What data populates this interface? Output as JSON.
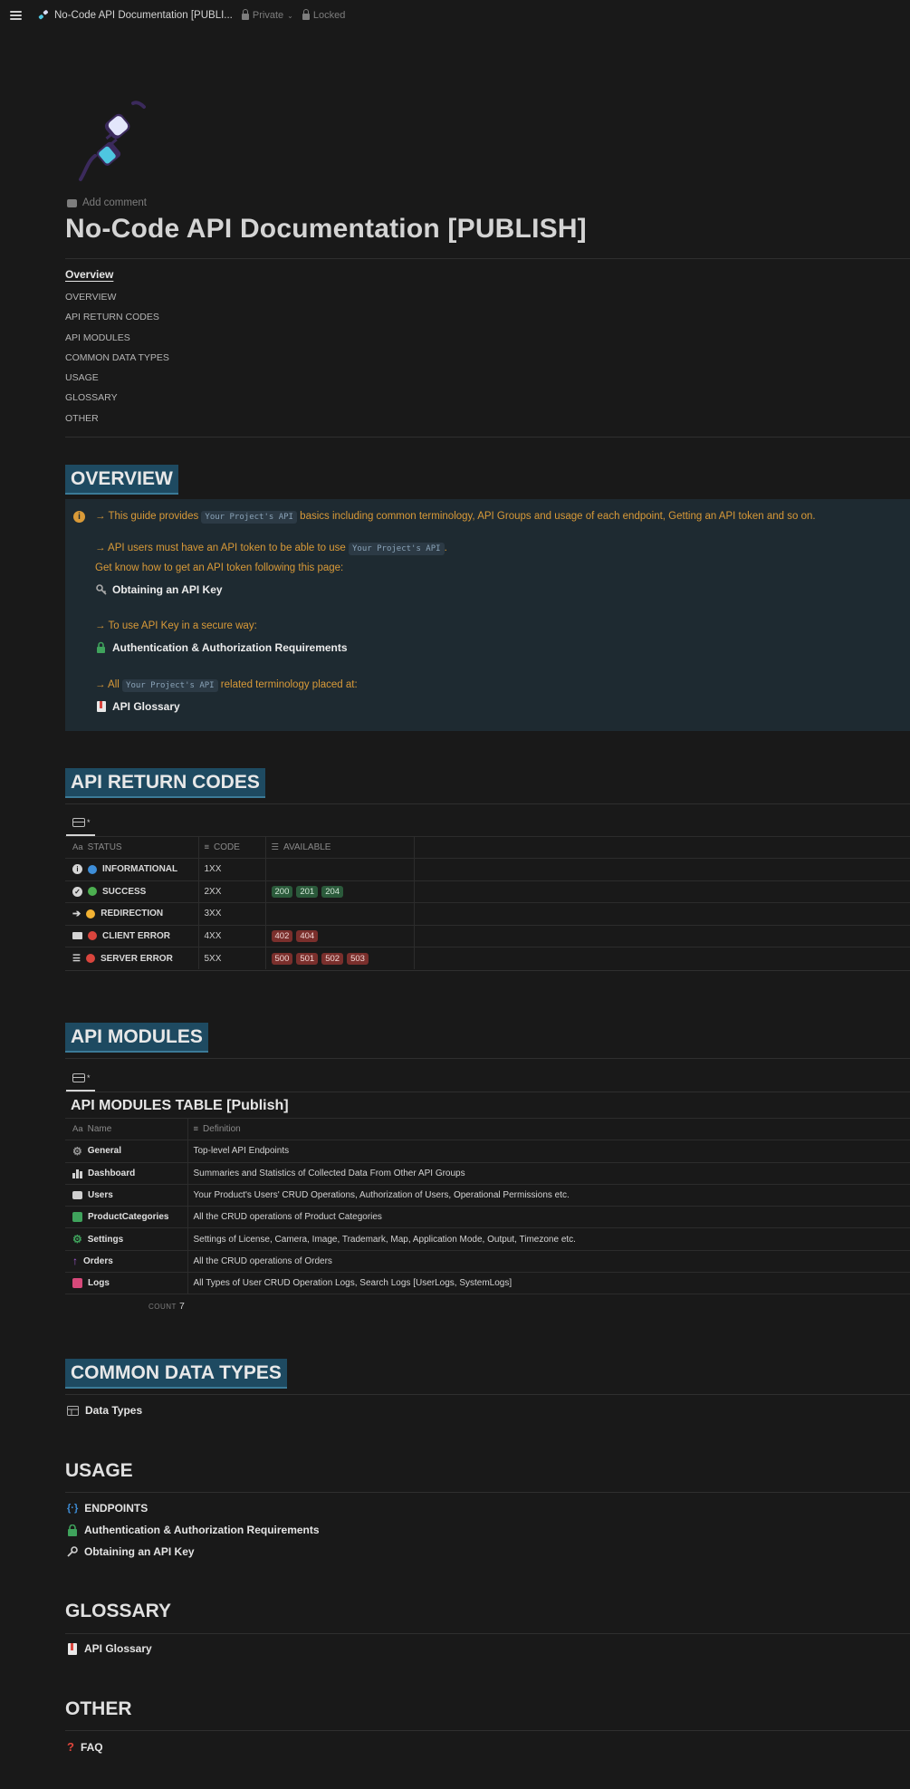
{
  "topbar": {
    "page_title": "No-Code API Documentation [PUBLI...",
    "privacy": "Private",
    "lock_state": "Locked"
  },
  "page": {
    "add_comment": "Add comment",
    "title": "No-Code API Documentation [PUBLISH]"
  },
  "toc": {
    "heading": "Overview",
    "items": [
      "OVERVIEW",
      "API RETURN CODES",
      "API MODULES",
      "COMMON DATA TYPES",
      "USAGE",
      "GLOSSARY",
      "OTHER"
    ]
  },
  "overview": {
    "heading": "OVERVIEW",
    "line1_pre": "→ This guide provides",
    "line1_code": "Your Project's API",
    "line1_post": "basics including common terminology, API Groups and usage of each endpoint, Getting an API token and so on.",
    "line2_pre": "→ API users must have an API token to be able to use",
    "line2_code": "Your Project's API",
    "line2_post": ".",
    "line3": "Get know how to get an API token following this page:",
    "link1": "Obtaining an API Key",
    "line4": "→ To use API Key in a secure way:",
    "link2": "Authentication & Authorization Requirements",
    "line5_pre": "→ All",
    "line5_code": "Your Project's API",
    "line5_post": "related terminology placed at:",
    "link3": "API Glossary"
  },
  "return_codes": {
    "heading": "API RETURN CODES",
    "view_tab": "*",
    "columns": {
      "status": "STATUS",
      "code": "CODE",
      "available": "AVAILABLE",
      "aa": "Aa"
    },
    "rows": [
      {
        "status": "INFORMATIONAL",
        "code": "1XX",
        "dot": "#3e8ed8",
        "tags": []
      },
      {
        "status": "SUCCESS",
        "code": "2XX",
        "dot": "#4caf50",
        "tags": [
          "200",
          "201",
          "204"
        ]
      },
      {
        "status": "REDIRECTION",
        "code": "3XX",
        "dot": "#f2b233",
        "tags": []
      },
      {
        "status": "CLIENT ERROR",
        "code": "4XX",
        "dot": "#d9453d",
        "tags": [
          "402",
          "404"
        ]
      },
      {
        "status": "SERVER ERROR",
        "code": "5XX",
        "dot": "#d9453d",
        "tags": [
          "500",
          "501",
          "502",
          "503"
        ]
      }
    ]
  },
  "modules": {
    "heading": "API MODULES",
    "view_tab": "*",
    "table_title": "API MODULES TABLE [Publish]",
    "columns": {
      "aa": "Aa",
      "name": "Name",
      "definition": "Definition"
    },
    "rows": [
      {
        "name": "General",
        "definition": "Top-level API Endpoints",
        "icon_color": "#9a9a9a"
      },
      {
        "name": "Dashboard",
        "definition": "Summaries and Statistics of Collected Data From Other API Groups",
        "icon_color": "#cfcfcf"
      },
      {
        "name": "Users",
        "definition": "Your Product's Users' CRUD Operations, Authorization of Users, Operational Permissions etc.",
        "icon_color": "#cfcfcf"
      },
      {
        "name": "ProductCategories",
        "definition": "All the CRUD operations of Product Categories",
        "icon_color": "#3fa35c"
      },
      {
        "name": "Settings",
        "definition": "Settings of License, Camera, Image, Trademark, Map, Application Mode, Output, Timezone etc.",
        "icon_color": "#3fa35c"
      },
      {
        "name": "Orders",
        "definition": "All the CRUD operations of Orders",
        "icon_color": "#a45bd6"
      },
      {
        "name": "Logs",
        "definition": "All Types of User CRUD Operation Logs, Search Logs [UserLogs, SystemLogs]",
        "icon_color": "#d6497a"
      }
    ],
    "count_label": "COUNT",
    "count_value": "7"
  },
  "data_types": {
    "heading": "COMMON DATA TYPES",
    "link": "Data Types"
  },
  "usage": {
    "heading": "USAGE",
    "links": [
      "ENDPOINTS",
      "Authentication & Authorization Requirements",
      "Obtaining an API Key"
    ]
  },
  "glossary": {
    "heading": "GLOSSARY",
    "link": "API Glossary"
  },
  "other": {
    "heading": "OTHER",
    "link": "FAQ"
  }
}
